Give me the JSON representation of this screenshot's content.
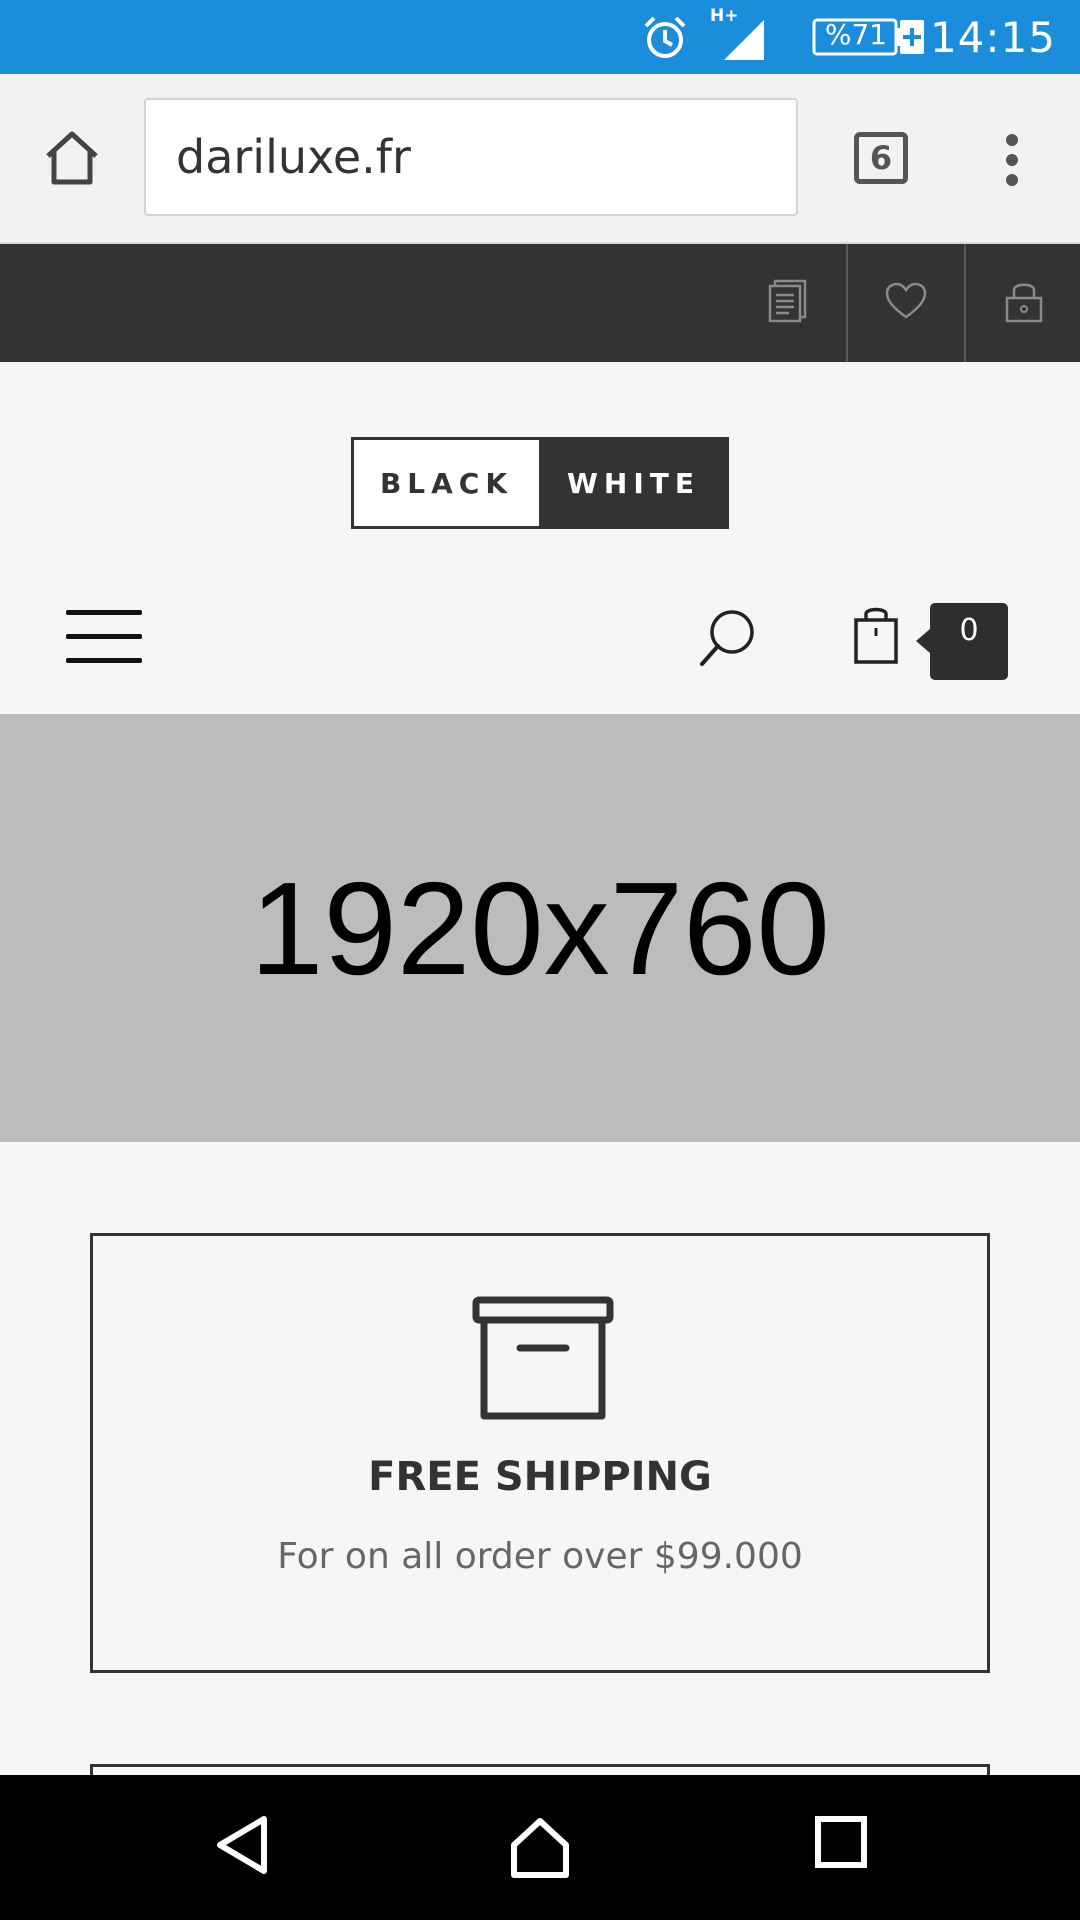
{
  "status_bar": {
    "time": "14:15",
    "battery": "%71",
    "network": "H+",
    "icons": [
      "alarm-icon",
      "signal-icon",
      "battery-charging-icon"
    ]
  },
  "browser": {
    "url": "dariluxe.fr",
    "tab_count": "6",
    "icons": [
      "home-icon",
      "more-vertical-icon"
    ]
  },
  "topbar": {
    "icons": [
      "notes-icon",
      "heart-icon",
      "lock-icon"
    ]
  },
  "logo": {
    "left_text": "BLACK",
    "right_text": "WHITE"
  },
  "header": {
    "cart_count": "0",
    "icons": [
      "menu-icon",
      "search-icon",
      "shopping-bag-icon"
    ]
  },
  "banner": {
    "text": "1920x760"
  },
  "features": [
    {
      "icon": "archive-box-icon",
      "title": "FREE SHIPPING",
      "description": "For on all order over $99.000"
    }
  ],
  "colors": {
    "status_bar": "#1c8ddb",
    "topbar": "#333333",
    "banner": "#bcbcbc",
    "page_background": "#f5f6f8"
  },
  "nav_bar": {
    "icons": [
      "back-icon",
      "home-nav-icon",
      "recents-icon"
    ]
  }
}
